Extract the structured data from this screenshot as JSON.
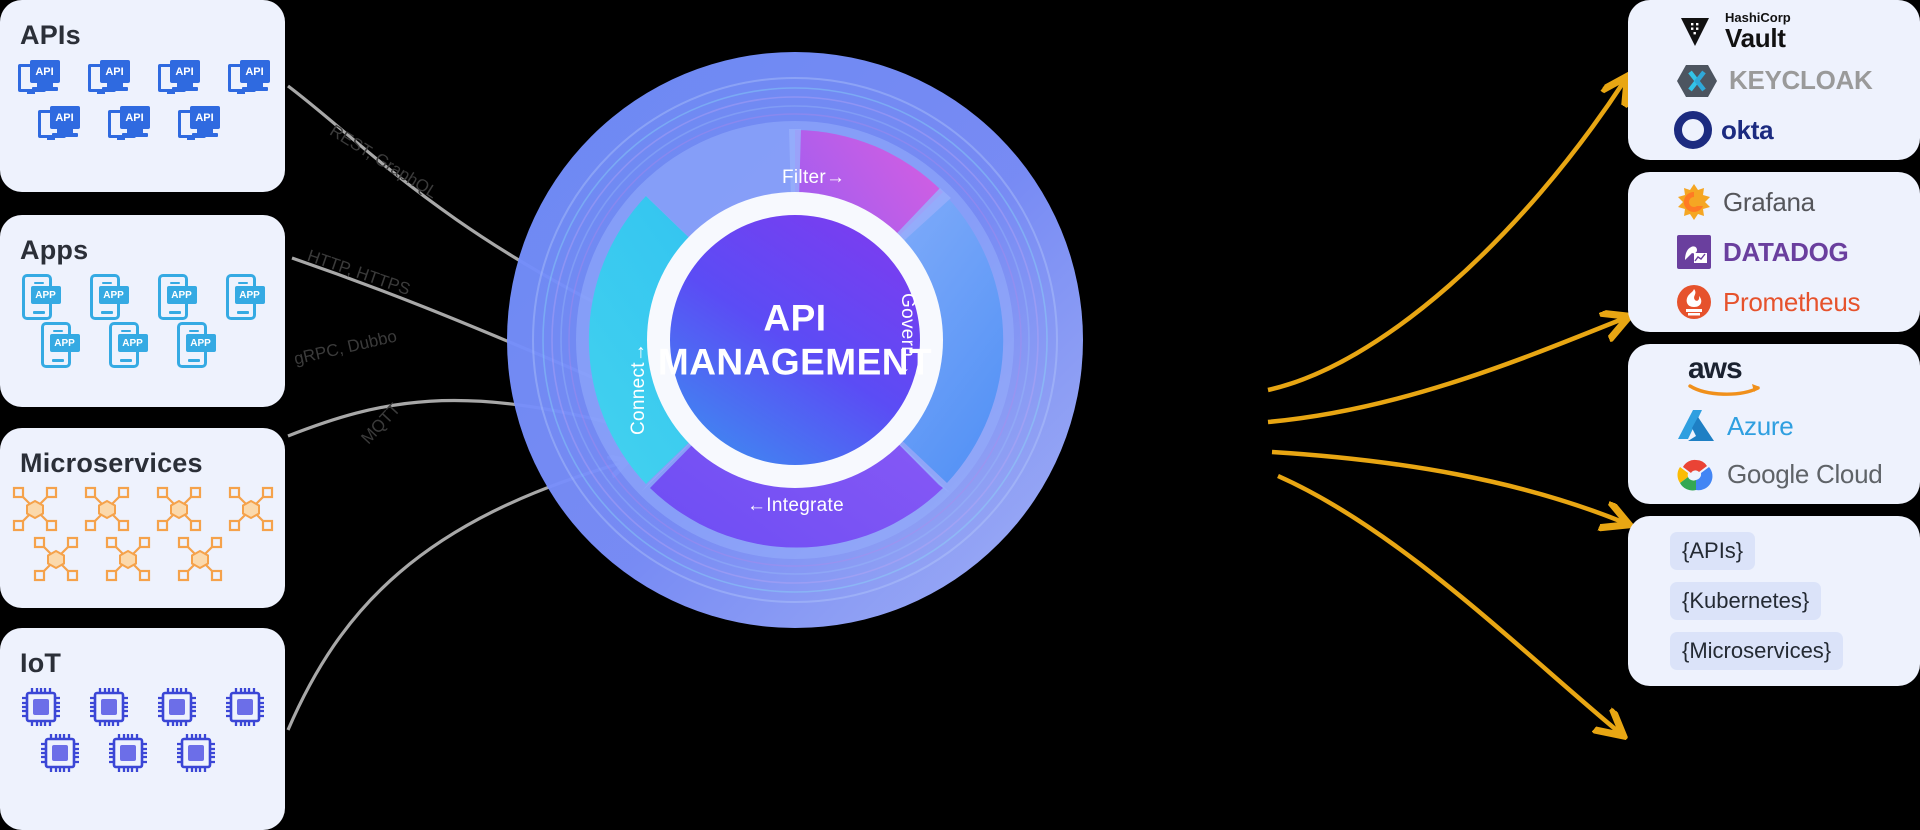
{
  "diagram": {
    "center": {
      "line1": "API",
      "line2": "MANAGEMENT"
    },
    "ring_segments": [
      {
        "name": "filter",
        "label": "Filter→",
        "color": "#a259f4"
      },
      {
        "name": "govern",
        "label": "Govern→",
        "color": "#5b8df8"
      },
      {
        "name": "integrate",
        "label": "←Integrate",
        "color": "#7c5cf0"
      },
      {
        "name": "connect",
        "label": "Connect→",
        "color": "#2ec5f0"
      }
    ],
    "protocol_labels": [
      {
        "name": "rest",
        "text": "REST, GraphQL"
      },
      {
        "name": "http",
        "text": "HTTP, HTTPS"
      },
      {
        "name": "grpc",
        "text": "gRPC, Dubbo"
      },
      {
        "name": "mqtt",
        "text": "MQTT"
      }
    ],
    "inbound_arrow_color": "#a8a8a8",
    "outbound_arrow_color": "#e8a613"
  },
  "sources": [
    {
      "id": "apis",
      "title": "APIs",
      "icon": "monitor-api-icon",
      "badge": "API",
      "count_row1": 4,
      "count_row2": 3,
      "color": "#2f6ae0"
    },
    {
      "id": "apps",
      "title": "Apps",
      "icon": "phone-app-icon",
      "badge": "APP",
      "count_row1": 4,
      "count_row2": 3,
      "color": "#35aae3"
    },
    {
      "id": "microservices",
      "title": "Microservices",
      "icon": "microservice-node-icon",
      "badge": "",
      "count_row1": 4,
      "count_row2": 3,
      "color": "#f5a24b"
    },
    {
      "id": "iot",
      "title": "IoT",
      "icon": "chip-icon",
      "badge": "",
      "count_row1": 4,
      "count_row2": 3,
      "color": "#3b46d6"
    }
  ],
  "targets": [
    {
      "id": "identity",
      "items": [
        {
          "name": "hashicorp-vault-logo",
          "brand": "HashiCorp",
          "text": "Vault",
          "color": "#111111"
        },
        {
          "name": "keycloak-logo",
          "brand": "",
          "text": "KEYCLOAK",
          "color": "#9a9a9a"
        },
        {
          "name": "okta-logo",
          "brand": "",
          "text": "okta",
          "color": "#1c2b80"
        }
      ]
    },
    {
      "id": "observability",
      "items": [
        {
          "name": "grafana-logo",
          "brand": "",
          "text": "Grafana",
          "color": "#55565b"
        },
        {
          "name": "datadog-logo",
          "brand": "",
          "text": "DATADOG",
          "color": "#6a3f9e"
        },
        {
          "name": "prometheus-logo",
          "brand": "",
          "text": "Prometheus",
          "color": "#e6522c"
        }
      ]
    },
    {
      "id": "cloud",
      "items": [
        {
          "name": "aws-logo",
          "brand": "",
          "text": "aws",
          "color": "#1b2230"
        },
        {
          "name": "azure-logo",
          "brand": "",
          "text": "Azure",
          "color": "#2f9fe0"
        },
        {
          "name": "google-cloud-logo",
          "brand": "",
          "text": "Google Cloud",
          "color": "#5f6368"
        }
      ]
    },
    {
      "id": "runtime",
      "items": [
        {
          "name": "apis-pill",
          "brand": "",
          "text": "{APIs}",
          "color": "#242a33"
        },
        {
          "name": "kubernetes-pill",
          "brand": "",
          "text": "{Kubernetes}",
          "color": "#242a33"
        },
        {
          "name": "microservices-pill",
          "brand": "",
          "text": "{Microservices}",
          "color": "#242a33"
        }
      ]
    }
  ]
}
